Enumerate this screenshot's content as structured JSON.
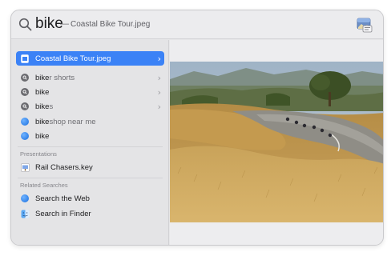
{
  "search": {
    "query": "bike",
    "separator": "—",
    "suggestion": "Coastal Bike Tour.jpeg"
  },
  "results": [
    {
      "label": "Coastal Bike Tour.jpeg",
      "icon": "jpeg-file-icon",
      "selected": true,
      "chevron": true
    },
    {
      "label_bold": "bike",
      "label_dim": "r shorts",
      "icon": "suggestion-search-icon",
      "chevron": true
    },
    {
      "label_bold": "bike",
      "label_dim": "",
      "icon": "suggestion-search-icon",
      "chevron": true
    },
    {
      "label_bold": "bike",
      "label_dim": "s",
      "icon": "suggestion-search-icon",
      "chevron": true
    },
    {
      "label_bold": "bike",
      "label_dim": " shop near me",
      "icon": "safari-icon",
      "chevron": false
    },
    {
      "label_bold": "bike",
      "label_dim": "",
      "icon": "safari-icon",
      "chevron": false
    }
  ],
  "sections": {
    "presentations": "Presentations",
    "related": "Related Searches"
  },
  "presentations": [
    {
      "label": "Rail Chasers.key",
      "icon": "keynote-file-icon"
    }
  ],
  "related": [
    {
      "label": "Search the Web",
      "icon": "safari-icon"
    },
    {
      "label": "Search in Finder",
      "icon": "finder-icon"
    }
  ],
  "chevron_glyph": "›",
  "colors": {
    "selection": "#3b82f6",
    "window_bg": "#e6e6e8"
  }
}
